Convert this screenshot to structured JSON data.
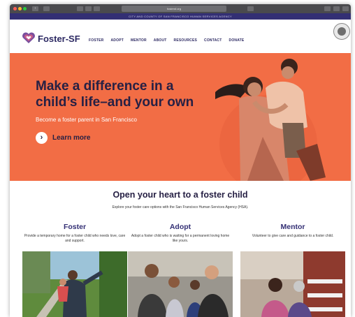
{
  "browser": {
    "address": "fostersf.org"
  },
  "agency_bar": {
    "text": "CITY AND COUNTY OF SAN FRANCISCO HUMAN SERVICES AGENCY"
  },
  "nav": {
    "logo_text": "Foster-SF",
    "links": [
      "FOSTER",
      "ADOPT",
      "MENTOR",
      "ABOUT",
      "RESOURCES",
      "CONTACT",
      "DONATE"
    ]
  },
  "hero": {
    "headline": "Make a difference in a child’s life–and your own",
    "subhead": "Become a foster parent in San Francisco",
    "cta": "Learn more"
  },
  "section": {
    "title": "Open your heart to a foster child",
    "subtitle": "Explore your foster care options with the San Francisco Human Services Agency (HSA)."
  },
  "options": [
    {
      "title": "Foster",
      "desc": "Provide a temporary home for a foster child who needs love, care and support."
    },
    {
      "title": "Adopt",
      "desc": "Adopt a foster child who is waiting for a permanent loving home like yours."
    },
    {
      "title": "Mentor",
      "desc": "Volunteer to give care and guidance to a foster child."
    }
  ],
  "colors": {
    "brand_navy": "#332f74",
    "hero_orange": "#f26d45",
    "heart_purple": "#7a4f9e"
  }
}
